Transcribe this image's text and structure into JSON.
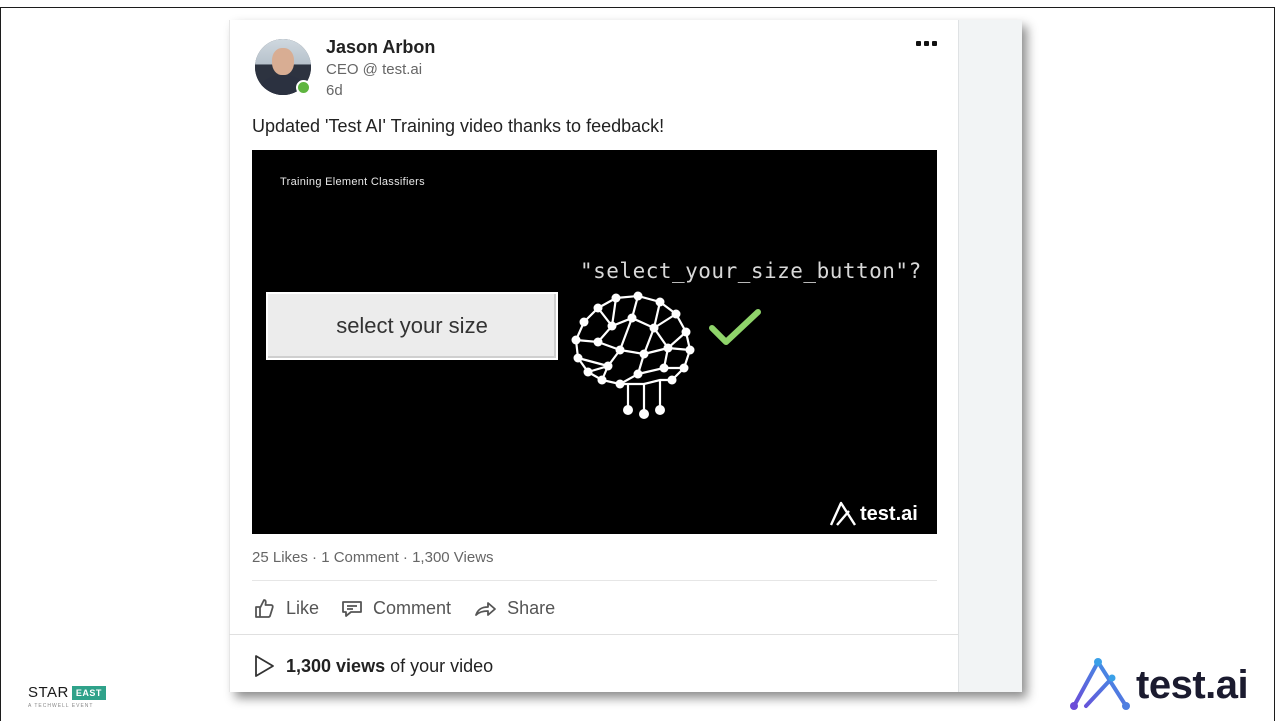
{
  "post": {
    "author_name": "Jason Arbon",
    "author_title": "CEO @ test.ai",
    "age": "6d",
    "text": "Updated 'Test AI' Training video thanks to feedback!"
  },
  "video": {
    "caption": "Training Element Classifiers",
    "question": "\"select_your_size_button\"?",
    "button_label": "select your size",
    "logo_text": "test.ai"
  },
  "stats": {
    "likes": "25 Likes",
    "sep1": " · ",
    "comments": "1 Comment",
    "sep2": " · ",
    "views": "1,300 Views"
  },
  "actions": {
    "like": "Like",
    "comment": "Comment",
    "share": "Share"
  },
  "footer": {
    "views_count": "1,300 views",
    "views_suffix": "of your video"
  },
  "branding": {
    "star": "STAR",
    "east": "EAST",
    "techwell": "A TECHWELL EVENT",
    "company": "test.ai"
  },
  "colors": {
    "online": "#5fb540",
    "check": "#8fd46a",
    "east_badge": "#2fa28a",
    "logo_purple": "#6b4bd8",
    "logo_blue": "#3aa0e8"
  }
}
